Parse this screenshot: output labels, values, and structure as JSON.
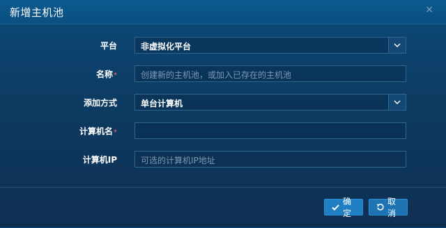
{
  "dialog": {
    "title": "新增主机池",
    "close_glyph": "×"
  },
  "form": {
    "platform": {
      "label": "平台",
      "value": "非虚拟化平台"
    },
    "name": {
      "label": "名称",
      "required_mark": "*",
      "placeholder": "创建新的主机池，或加入已存在的主机池"
    },
    "add_method": {
      "label": "添加方式",
      "value": "单台计算机"
    },
    "computer_name": {
      "label": "计算机名",
      "required_mark": "*",
      "value": ""
    },
    "computer_ip": {
      "label": "计算机IP",
      "placeholder": "可选的计算机IP地址"
    }
  },
  "buttons": {
    "confirm": "确定",
    "cancel": "取消"
  },
  "colors": {
    "accent": "#1f7fc2",
    "background_top": "#0b4a78",
    "background_bottom": "#0f2f52",
    "required": "#ff6b6b"
  }
}
